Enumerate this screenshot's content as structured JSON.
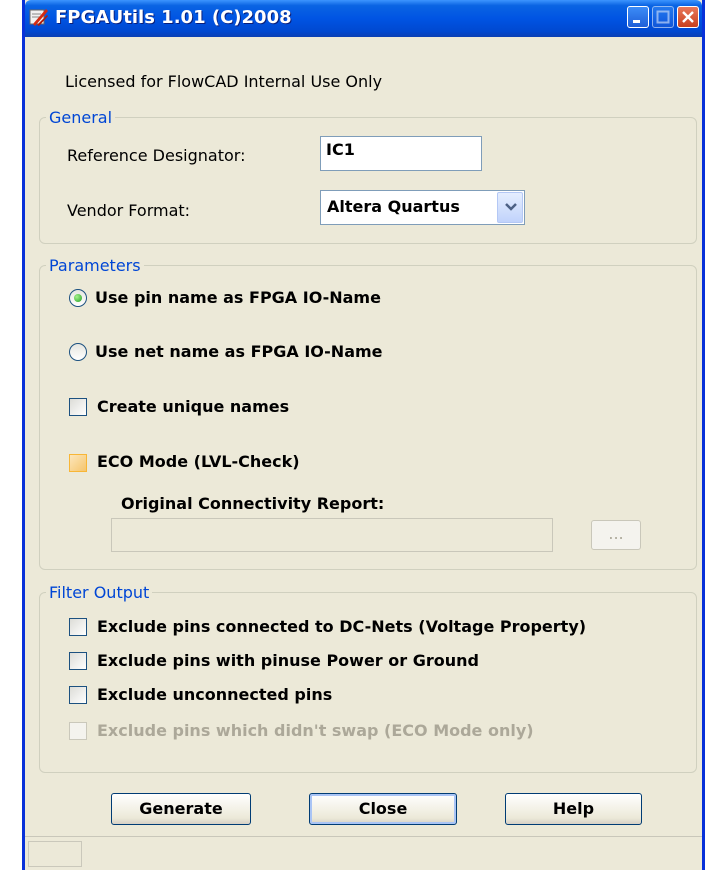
{
  "window": {
    "title": "FPGAUtils 1.01 (C)2008"
  },
  "license_text": "Licensed for FlowCAD Internal Use Only",
  "general": {
    "legend": "General",
    "ref_designator_label": "Reference Designator:",
    "ref_designator_value": "IC1",
    "vendor_format_label": "Vendor Format:",
    "vendor_format_value": "Altera Quartus"
  },
  "parameters": {
    "legend": "Parameters",
    "radio_pin_name": "Use pin name as FPGA IO-Name",
    "radio_net_name": "Use net name as FPGA IO-Name",
    "selected_radio": "pin_name",
    "unique_names": "Create unique names",
    "eco_mode": "ECO Mode (LVL-Check)",
    "report_label": "Original Connectivity Report:",
    "report_value": "",
    "browse_label": "..."
  },
  "filter_output": {
    "legend": "Filter Output",
    "options": [
      {
        "label": "Exclude pins connected to DC-Nets (Voltage Property)",
        "checked": false,
        "enabled": true
      },
      {
        "label": "Exclude pins with pinuse Power or Ground",
        "checked": false,
        "enabled": true
      },
      {
        "label": "Exclude unconnected pins",
        "checked": false,
        "enabled": true
      },
      {
        "label": "Exclude pins which didn't swap (ECO Mode only)",
        "checked": false,
        "enabled": false
      }
    ]
  },
  "buttons": {
    "generate": "Generate",
    "close": "Close",
    "help": "Help"
  },
  "colors": {
    "title_bar": "#0054e3",
    "legend": "#0046d5",
    "dialog_bg": "#ece9d8"
  }
}
